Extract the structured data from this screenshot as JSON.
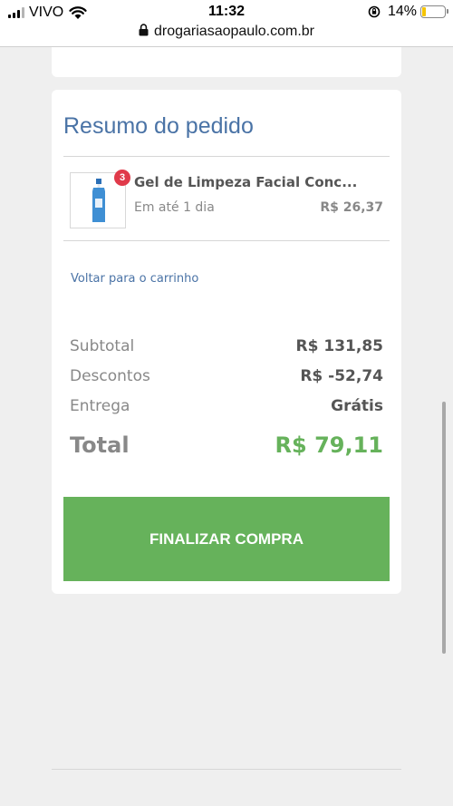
{
  "status_bar": {
    "carrier": "VIVO",
    "time": "11:32",
    "battery": "14%",
    "battery_level": 0.14,
    "url": "drogariasaopaulo.com.br"
  },
  "summary": {
    "title": "Resumo do pedido",
    "product": {
      "name": "Gel de Limpeza Facial Conc...",
      "quantity": "3",
      "delivery": "Em até 1 dia",
      "price": "R$ 26,37"
    },
    "back_link": "Voltar para o carrinho",
    "rows": [
      {
        "label": "Subtotal",
        "value": "R$ 131,85"
      },
      {
        "label": "Descontos",
        "value": "R$ -52,74"
      },
      {
        "label": "Entrega",
        "value": "Grátis"
      }
    ],
    "total_label": "Total",
    "total_value": "R$ 79,11",
    "checkout_label": "FINALIZAR COMPRA"
  },
  "colors": {
    "accent_blue": "#4a73a6",
    "accent_green": "#66b25b",
    "badge_red": "#e03a4a"
  },
  "icons": [
    "signal-icon",
    "wifi-icon",
    "rotation-lock-icon",
    "battery-icon",
    "lock-icon",
    "product-bottle-icon"
  ]
}
